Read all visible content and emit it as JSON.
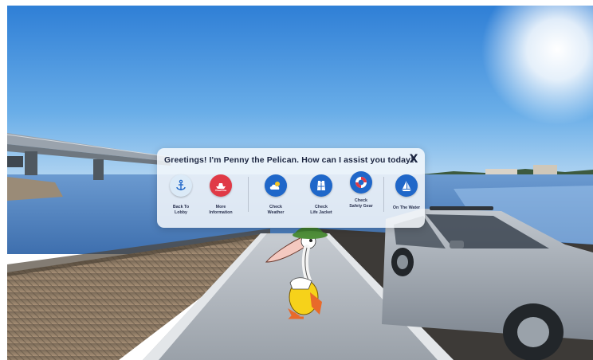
{
  "dialog": {
    "greeting": "Greetings! I'm Penny the Pelican. How can I assist you today?",
    "close_label": "X"
  },
  "options": [
    {
      "line1": "Back To",
      "line2": "Lobby",
      "icon": "anchor-icon",
      "color": "#dbeaf7"
    },
    {
      "line1": "More",
      "line2": "Information",
      "icon": "boat-icon",
      "color": "#e03a46"
    },
    {
      "line1": "Check",
      "line2": "Weather",
      "icon": "cloud-icon",
      "color": "#1f67c9"
    },
    {
      "line1": "Check",
      "line2": "Life Jacket",
      "icon": "life-jacket-icon",
      "color": "#1f67c9"
    },
    {
      "line1": "Check",
      "line2": "Safety Gear",
      "icon": "life-ring-icon",
      "color": "#1f67c9"
    },
    {
      "line1": "On The Water",
      "line2": "",
      "icon": "sailboat-icon",
      "color": "#1f67c9"
    }
  ],
  "colors": {
    "sky_top": "#2f7fd6",
    "water": "#4f84c2",
    "primary_blue": "#1f67c9",
    "info_red": "#e03a46"
  }
}
